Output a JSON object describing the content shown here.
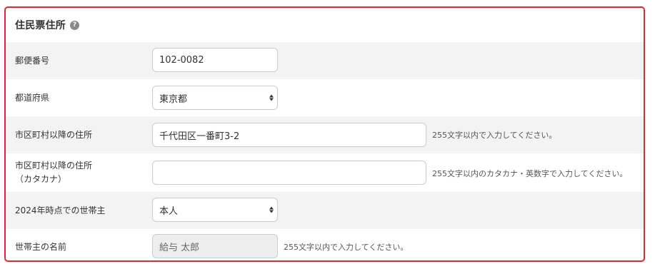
{
  "section": {
    "title": "住民票住所",
    "help_icon": "question-circle-icon",
    "accent_color": "#e8262d"
  },
  "fields": {
    "postal": {
      "label": "郵便番号",
      "value": "102-0082"
    },
    "prefecture": {
      "label": "都道府県",
      "value": "東京都"
    },
    "address": {
      "label": "市区町村以降の住所",
      "value": "千代田区一番町3-2",
      "hint": "255文字以内で入力してください。"
    },
    "address_kana": {
      "label_line1": "市区町村以降の住所",
      "label_line2": "（カタカナ）",
      "value": "",
      "hint": "255文字以内のカタカナ・英数字で入力してください。"
    },
    "householder_2024": {
      "label": "2024年時点での世帯主",
      "value": "本人"
    },
    "householder_name": {
      "label": "世帯主の名前",
      "value": "給与 太郎",
      "hint": "255文字以内で入力してください。"
    }
  }
}
